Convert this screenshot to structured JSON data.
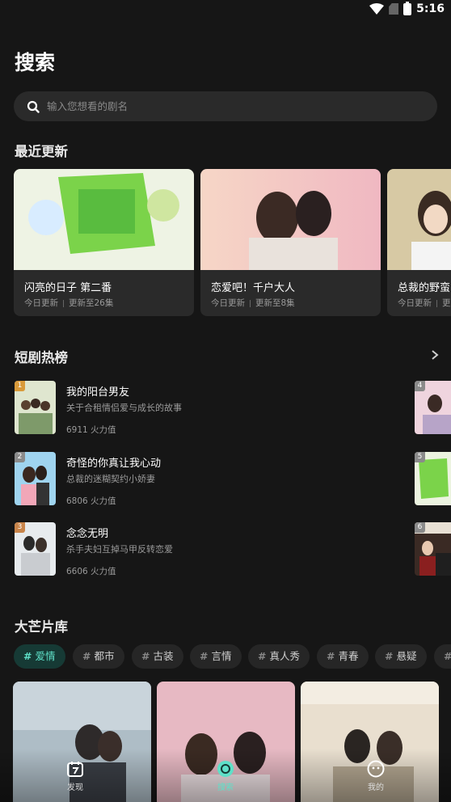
{
  "status": {
    "time": "5:16"
  },
  "page": {
    "title": "搜索"
  },
  "search": {
    "placeholder": "输入您想看的剧名"
  },
  "recent": {
    "title": "最近更新",
    "cards": [
      {
        "name": "闪亮的日子 第二番",
        "date": "今日更新",
        "progress": "更新至26集"
      },
      {
        "name": "恋爱吧！千户大人",
        "date": "今日更新",
        "progress": "更新至8集"
      },
      {
        "name": "总裁的野蛮",
        "date": "今日更新",
        "progress": "更"
      }
    ]
  },
  "hot": {
    "title": "短剧热榜",
    "items": [
      {
        "rank": "1",
        "title": "我的阳台男友",
        "desc": "关于合租情侣爱与成长的故事",
        "heat": "6911 火力值",
        "badge_color": "#d99a3a"
      },
      {
        "rank": "2",
        "title": "奇怪的你真让我心动",
        "desc": "总裁的迷糊契约小娇妻",
        "heat": "6806 火力值",
        "badge_color": "#8a8a8a"
      },
      {
        "rank": "3",
        "title": "念念无明",
        "desc": "杀手夫妇互掉马甲反转恋爱",
        "heat": "6606 火力值",
        "badge_color": "#c8844a"
      }
    ],
    "right_ranks": [
      "4",
      "5",
      "6"
    ]
  },
  "library": {
    "title": "大芒片库",
    "tags": [
      "爱情",
      "都市",
      "古装",
      "言情",
      "真人秀",
      "青春",
      "悬疑",
      ""
    ],
    "active_tag": "爱情"
  },
  "nav": {
    "items": [
      {
        "label": "发现"
      },
      {
        "label": "搜索"
      },
      {
        "label": "我的"
      }
    ]
  },
  "colors": {
    "accent": "#5ee0c8",
    "background": "#161616",
    "card": "#2a2a2a"
  }
}
